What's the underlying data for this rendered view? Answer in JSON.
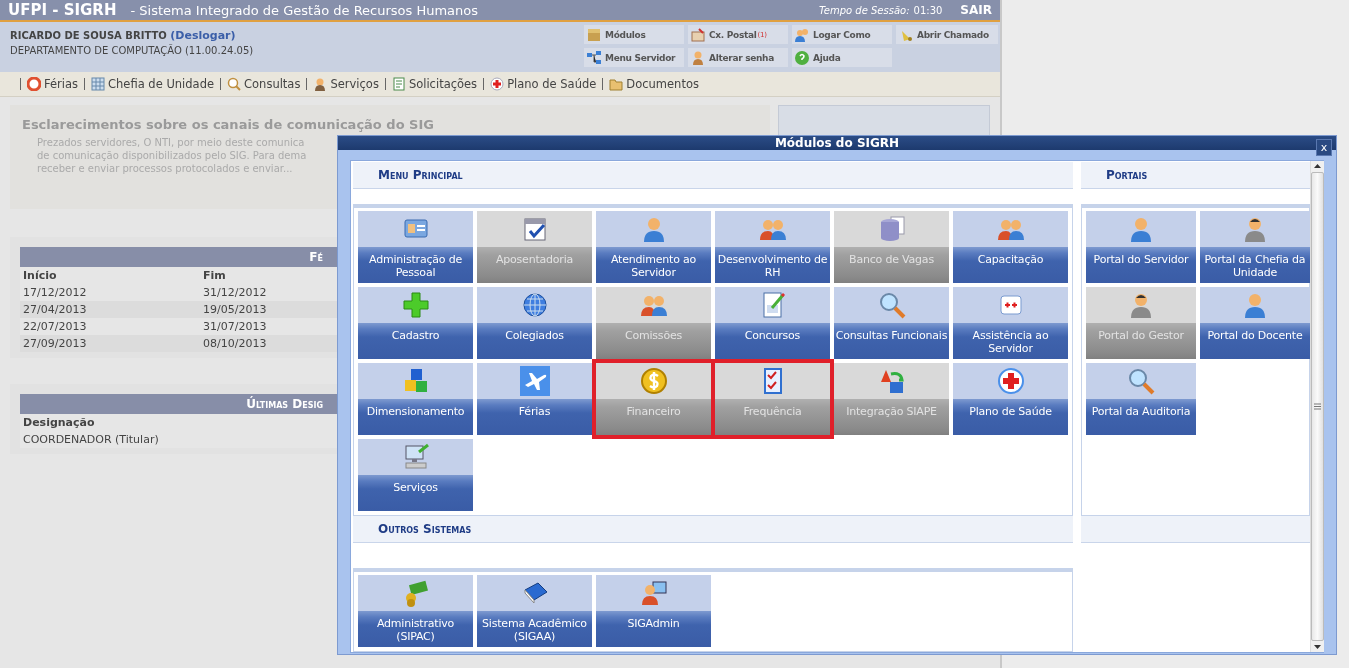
{
  "header": {
    "system": "UFPI - SIGRH",
    "subtitle": "- Sistema Integrado de Gestão de Recursos Humanos",
    "session_label": "Tempo de Sessão:",
    "session_time": "01:30",
    "logout": "SAIR"
  },
  "user": {
    "name": "RICARDO DE SOUSA BRITTO",
    "logout_link": "(Deslogar)",
    "department": "DEPARTAMENTO DE COMPUTAÇÃO (11.00.24.05)"
  },
  "quick_links": [
    {
      "label": "Módulos"
    },
    {
      "label": "Cx. Postal",
      "badge": "(1)"
    },
    {
      "label": "Logar Como"
    },
    {
      "label": "Abrir Chamado"
    },
    {
      "label": "Menu Servidor"
    },
    {
      "label": "Alterar senha"
    },
    {
      "label": "Ajuda"
    }
  ],
  "menu": [
    "Férias",
    "Chefia de Unidade",
    "Consultas",
    "Serviços",
    "Solicitações",
    "Plano de Saúde",
    "Documentos"
  ],
  "notice": {
    "title": "Esclarecimentos sobre os canais de comunicação do SIG",
    "lines": [
      "Prezados servidores, O NTI, por meio deste comunica",
      "de comunicação disponibilizados pelo SIG. Para dema",
      "receber e enviar processos protocolados e enviar..."
    ]
  },
  "vacations": {
    "title": "Fé",
    "columns": [
      "Início",
      "Fim"
    ],
    "rows": [
      [
        "17/12/2012",
        "31/12/2012"
      ],
      [
        "27/04/2013",
        "19/05/2013"
      ],
      [
        "22/07/2013",
        "31/07/2013"
      ],
      [
        "27/09/2013",
        "08/10/2013"
      ]
    ]
  },
  "designations": {
    "title": "Últimas Desig",
    "columns": [
      "Designação"
    ],
    "rows": [
      [
        "COORDENADOR (Titular)"
      ]
    ]
  },
  "modal": {
    "title": "Módulos do SIGRH",
    "close": "x",
    "sections": [
      {
        "title": "Menu Principal",
        "tiles": [
          {
            "label": "Administração de Pessoal",
            "disabled": false,
            "highlighted": false
          },
          {
            "label": "Aposentadoria",
            "disabled": true,
            "highlighted": false
          },
          {
            "label": "Atendimento ao Servidor",
            "disabled": false,
            "highlighted": false
          },
          {
            "label": "Desenvolvimento de RH",
            "disabled": false,
            "highlighted": false
          },
          {
            "label": "Banco de Vagas",
            "disabled": true,
            "highlighted": false
          },
          {
            "label": "Capacitação",
            "disabled": false,
            "highlighted": false
          },
          {
            "label": "Cadastro",
            "disabled": false,
            "highlighted": false
          },
          {
            "label": "Colegiados",
            "disabled": false,
            "highlighted": false
          },
          {
            "label": "Comissões",
            "disabled": true,
            "highlighted": false
          },
          {
            "label": "Concursos",
            "disabled": false,
            "highlighted": false
          },
          {
            "label": "Consultas Funcionais",
            "disabled": false,
            "highlighted": false
          },
          {
            "label": "Assistência ao Servidor",
            "disabled": false,
            "highlighted": false
          },
          {
            "label": "Dimensionamento",
            "disabled": false,
            "highlighted": false
          },
          {
            "label": "Férias",
            "disabled": false,
            "highlighted": false
          },
          {
            "label": "Financeiro",
            "disabled": true,
            "highlighted": true
          },
          {
            "label": "Frequência",
            "disabled": true,
            "highlighted": true
          },
          {
            "label": "Integração SIAPE",
            "disabled": true,
            "highlighted": false
          },
          {
            "label": "Plano de Saúde",
            "disabled": false,
            "highlighted": false
          },
          {
            "label": "Serviços",
            "disabled": false,
            "highlighted": false
          }
        ]
      },
      {
        "title": "Portais",
        "tiles": [
          {
            "label": "Portal do Servidor",
            "disabled": false,
            "highlighted": false
          },
          {
            "label": "Portal da Chefia da Unidade",
            "disabled": false,
            "highlighted": false
          },
          {
            "label": "Portal do Gestor",
            "disabled": true,
            "highlighted": false
          },
          {
            "label": "Portal do Docente",
            "disabled": false,
            "highlighted": false
          },
          {
            "label": "Portal da Auditoria",
            "disabled": false,
            "highlighted": false
          }
        ]
      },
      {
        "title": "Outros Sistemas",
        "tiles": [
          {
            "label": "Administrativo (SIPAC)",
            "disabled": false,
            "highlighted": false
          },
          {
            "label": "Sistema Acadêmico (SIGAA)",
            "disabled": false,
            "highlighted": false
          },
          {
            "label": "SIGAdmin",
            "disabled": false,
            "highlighted": false
          }
        ]
      }
    ]
  }
}
